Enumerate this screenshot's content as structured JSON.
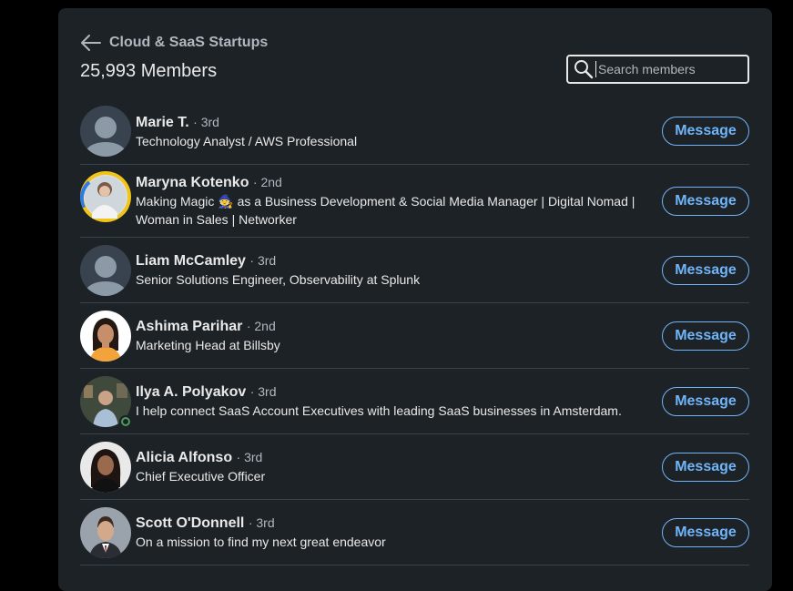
{
  "header": {
    "group_name": "Cloud & SaaS Startups",
    "members_count": "25,993 Members"
  },
  "search": {
    "placeholder": "Search members",
    "value": ""
  },
  "colors": {
    "background": "#1d2226",
    "accent": "#70b5f9",
    "text_primary": "#e9e9e9",
    "text_secondary": "#b0b7bf",
    "divider": "#38434f",
    "online": "#4ca35c"
  },
  "members": [
    {
      "name": "Marie T.",
      "degree": "· 3rd",
      "headline": "Technology Analyst / AWS Professional",
      "avatar": "placeholder-avatar-icon",
      "button_label": "Message"
    },
    {
      "name": "Maryna Kotenko",
      "degree": "· 2nd",
      "headline": "Making Magic 🧙 as a Business Development & Social Media Manager | Digital Nomad | Woman in Sales | Networker",
      "avatar": "photo-avatar-open-to-work",
      "button_label": "Message"
    },
    {
      "name": "Liam McCamley",
      "degree": "· 3rd",
      "headline": "Senior Solutions Engineer, Observability at Splunk",
      "avatar": "placeholder-avatar-icon",
      "button_label": "Message"
    },
    {
      "name": "Ashima Parihar",
      "degree": "· 2nd",
      "headline": "Marketing Head at Billsby",
      "avatar": "photo-avatar",
      "button_label": "Message"
    },
    {
      "name": "Ilya A. Polyakov",
      "degree": "· 3rd",
      "headline": "I help connect SaaS Account Executives with leading SaaS businesses in Amsterdam.",
      "avatar": "photo-avatar-online",
      "button_label": "Message"
    },
    {
      "name": "Alicia Alfonso",
      "degree": "· 3rd",
      "headline": "Chief Executive Officer",
      "avatar": "photo-avatar",
      "button_label": "Message"
    },
    {
      "name": "Scott O'Donnell",
      "degree": "· 3rd",
      "headline": "On a mission to find my next great endeavor",
      "avatar": "photo-avatar",
      "button_label": "Message"
    }
  ]
}
